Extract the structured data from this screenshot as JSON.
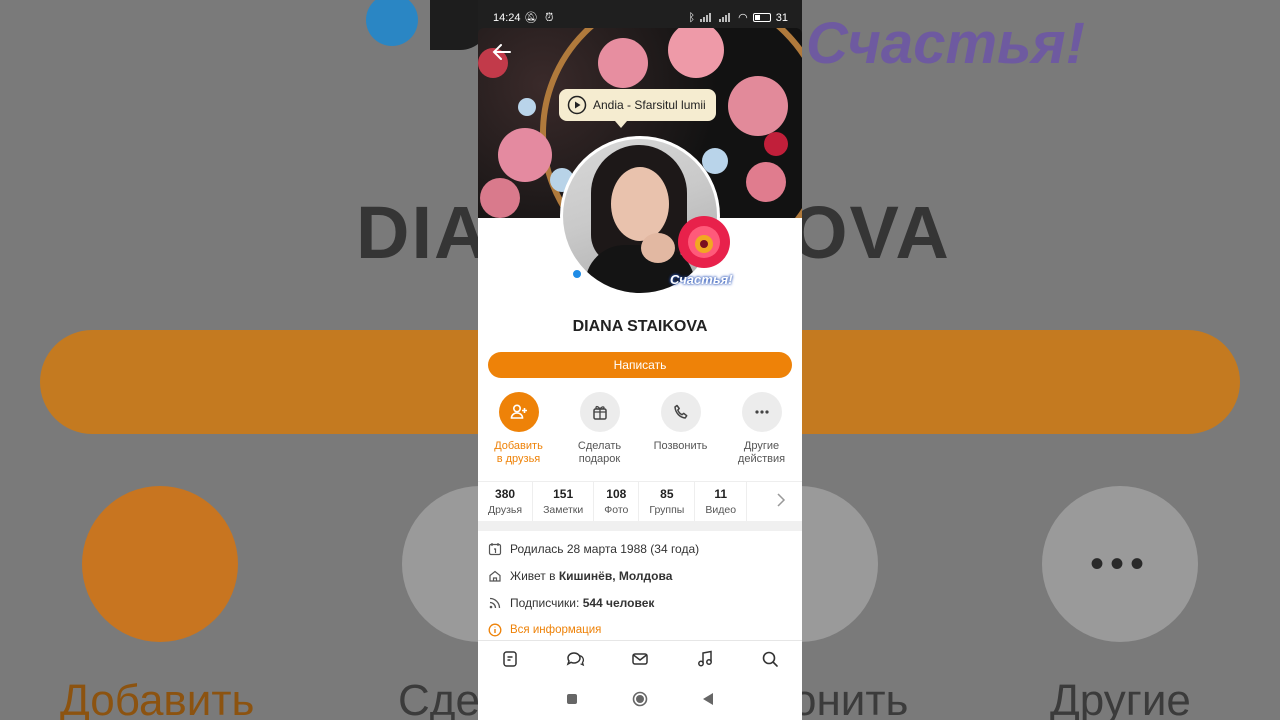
{
  "background": {
    "big_text_left": "DIA",
    "big_text_right": "OVA",
    "script_text": "Счастья!",
    "labels": [
      "Добавить",
      "Сде",
      "онить",
      "Другие"
    ]
  },
  "statusbar": {
    "time": "14:24",
    "battery": "31"
  },
  "profile": {
    "music_track": "Andia - Sfarsitul lumii",
    "name": "DIANA STAIKOVA",
    "sticker_text": "Счастья!",
    "write_button": "Написать"
  },
  "actions": [
    {
      "label1": "Добавить",
      "label2": "в друзья",
      "icon": "add-friend-icon"
    },
    {
      "label1": "Сделать",
      "label2": "подарок",
      "icon": "gift-icon"
    },
    {
      "label1": "Позвонить",
      "label2": "",
      "icon": "phone-icon"
    },
    {
      "label1": "Другие",
      "label2": "действия",
      "icon": "more-icon"
    }
  ],
  "stats": [
    {
      "num": "380",
      "cap": "Друзья"
    },
    {
      "num": "151",
      "cap": "Заметки"
    },
    {
      "num": "108",
      "cap": "Фото"
    },
    {
      "num": "85",
      "cap": "Группы"
    },
    {
      "num": "11",
      "cap": "Видео"
    }
  ],
  "info": {
    "birth": "Родилась 28 марта 1988 (34 года)",
    "lives_prefix": "Живет в ",
    "lives_place": "Кишинёв, Молдова",
    "subs_prefix": "Подписчики: ",
    "subs_count": "544 человек",
    "all_info": "Вся информация"
  },
  "colors": {
    "accent": "#ee8208",
    "online": "#1f8ce6"
  }
}
